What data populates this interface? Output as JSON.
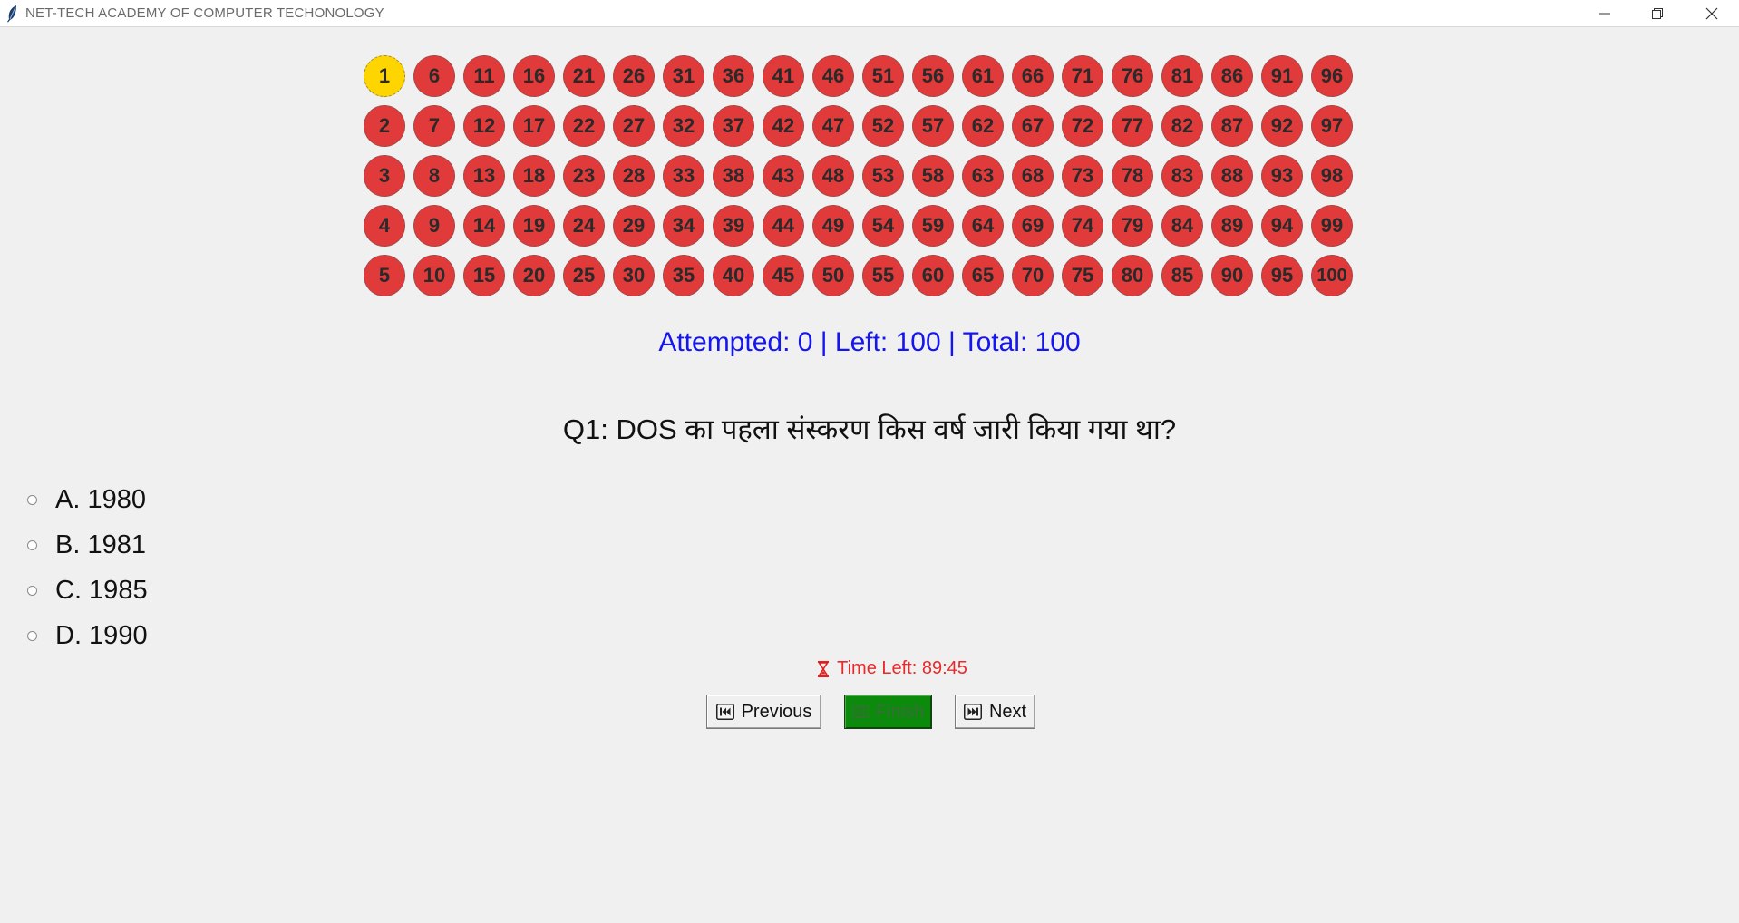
{
  "window": {
    "title": "NET-TECH ACADEMY OF COMPUTER TECHONOLOGY",
    "icon": "feather-icon",
    "controls": [
      "minimize-icon",
      "restore-icon",
      "close-icon"
    ]
  },
  "question_grid": {
    "current": "1",
    "rows": [
      [
        "1",
        "6",
        "11",
        "16",
        "21",
        "26",
        "31",
        "36",
        "41",
        "46",
        "51",
        "56",
        "61",
        "66",
        "71",
        "76",
        "81",
        "86",
        "91",
        "96"
      ],
      [
        "2",
        "7",
        "12",
        "17",
        "22",
        "27",
        "32",
        "37",
        "42",
        "47",
        "52",
        "57",
        "62",
        "67",
        "72",
        "77",
        "82",
        "87",
        "92",
        "97"
      ],
      [
        "3",
        "8",
        "13",
        "18",
        "23",
        "28",
        "33",
        "38",
        "43",
        "48",
        "53",
        "58",
        "63",
        "68",
        "73",
        "78",
        "83",
        "88",
        "93",
        "98"
      ],
      [
        "4",
        "9",
        "14",
        "19",
        "24",
        "29",
        "34",
        "39",
        "44",
        "49",
        "54",
        "59",
        "64",
        "69",
        "74",
        "79",
        "84",
        "89",
        "94",
        "99"
      ],
      [
        "5",
        "10",
        "15",
        "20",
        "25",
        "30",
        "35",
        "40",
        "45",
        "50",
        "55",
        "60",
        "65",
        "70",
        "75",
        "80",
        "85",
        "90",
        "95",
        "100"
      ]
    ],
    "colors": {
      "unanswered": "#e13a3a",
      "current": "#ffd500"
    }
  },
  "stats": {
    "text": "Attempted: 0 | Left: 100 | Total: 100",
    "color": "#1515f0"
  },
  "question": {
    "text": "Q1: DOS का पहला संस्करण किस वर्ष जारी किया गया था?"
  },
  "options": [
    {
      "label": "A. 1980"
    },
    {
      "label": "B. 1981"
    },
    {
      "label": "C. 1985"
    },
    {
      "label": "D. 1990"
    }
  ],
  "timer": {
    "icon": "hourglass-icon",
    "text": "Time Left: 89:45",
    "color": "#ea2a2a"
  },
  "nav": {
    "previous": {
      "label": "Previous",
      "icon": "previous-icon"
    },
    "finish": {
      "label": "Finish",
      "icon": "finish-icon",
      "color": "#0c8a0c"
    },
    "next": {
      "label": "Next",
      "icon": "next-icon"
    }
  }
}
